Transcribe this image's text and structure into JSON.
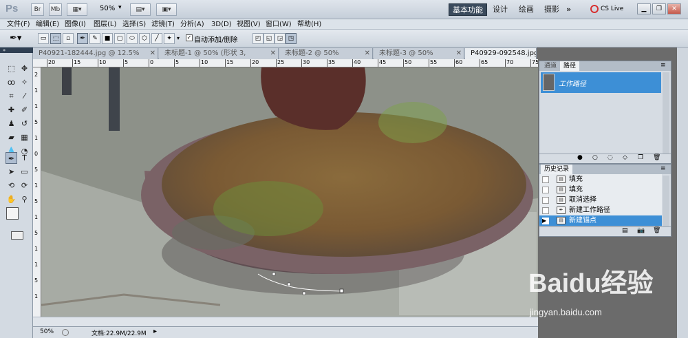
{
  "app": {
    "logo": "Ps",
    "zoom": "50%",
    "workspaces": [
      "基本功能",
      "设计",
      "绘画",
      "摄影"
    ],
    "more": "»",
    "cslive": "CS Live"
  },
  "menu": [
    "文件(F)",
    "编辑(E)",
    "图像(I)",
    "图层(L)",
    "选择(S)",
    "滤镜(T)",
    "分析(A)",
    "3D(D)",
    "视图(V)",
    "窗口(W)",
    "帮助(H)"
  ],
  "options": {
    "auto_add_label": "自动添加/删除"
  },
  "tabs": [
    {
      "label": "P40921-182444.jpg @ 12.5%(RGB/8) *"
    },
    {
      "label": "未标题-1 @ 50% (形状 3, RGB/8) *"
    },
    {
      "label": "未标题-2 @ 50%(RGB/8) *"
    },
    {
      "label": "未标题-3 @ 50%(RGB/8) *"
    },
    {
      "label": "P40929-092548.jpg @ 50%(RGB/8) *"
    }
  ],
  "ruler_h": [
    "20",
    "15",
    "10",
    "5",
    "0",
    "5",
    "10",
    "15",
    "20",
    "25",
    "30",
    "35",
    "40",
    "45",
    "50",
    "55",
    "60",
    "65",
    "70",
    "75"
  ],
  "ruler_v": [
    "2",
    "1",
    "1",
    "5",
    "1",
    "0",
    "5",
    "1",
    "5",
    "1",
    "5",
    "1",
    "1",
    "5",
    "1"
  ],
  "paths_panel": {
    "tabs": [
      "通道",
      "路径"
    ],
    "item": "工作路径"
  },
  "history_panel": {
    "title": "历史记录",
    "rows": [
      "填充",
      "填充",
      "取消选择",
      "新建工作路径",
      "新建锚点"
    ],
    "selected_index": 4
  },
  "status": {
    "zoom": "50%",
    "doc": "文档:22.9M/22.9M"
  },
  "watermark": {
    "text": "Baidu经验",
    "url": "jingyan.baidu.com"
  }
}
